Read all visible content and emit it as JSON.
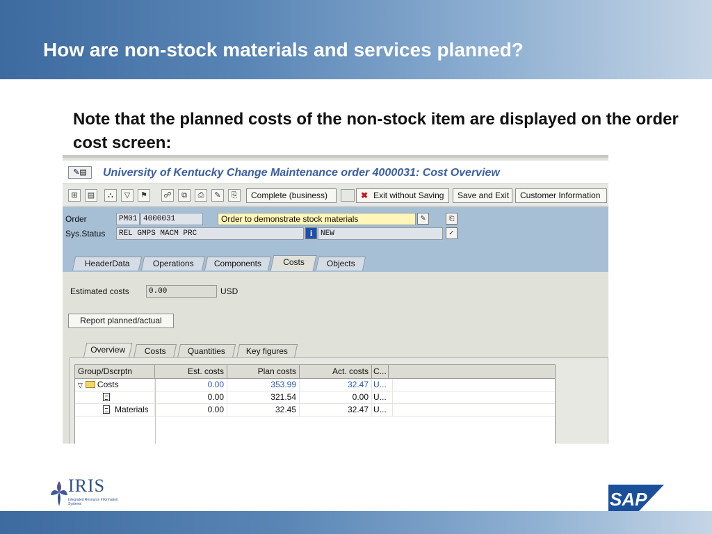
{
  "slide": {
    "title": "How are non-stock materials and services planned?",
    "note": "Note that the planned costs of the non-stock item are displayed on the order cost screen:"
  },
  "sap_window": {
    "title": "University of Kentucky Change Maintenance order 4000031: Cost Overview",
    "toolbar": {
      "complete_label": "Complete (business)",
      "exit_label": "Exit without Saving",
      "save_exit_label": "Save and Exit",
      "customer_info_label": "Customer Information"
    },
    "header": {
      "order_label": "Order",
      "order_type": "PM01",
      "order_number": "4000031",
      "order_description": "Order to demonstrate stock materials",
      "sys_status_label": "Sys.Status",
      "sys_status_value": "REL  GMPS MACM PRC",
      "user_status_value": "NEW"
    },
    "tabs": [
      "HeaderData",
      "Operations",
      "Components",
      "Costs",
      "Objects"
    ],
    "active_tab": "Costs",
    "costs": {
      "estimated_label": "Estimated costs",
      "estimated_value": "0.00",
      "currency": "USD",
      "report_button": "Report planned/actual",
      "sub_tabs": [
        "Overview",
        "Costs",
        "Quantities",
        "Key figures"
      ],
      "active_sub_tab": "Overview",
      "table": {
        "columns": [
          "Group/Dscrptn",
          "Est. costs",
          "Plan costs",
          "Act. costs",
          "C..."
        ],
        "rows": [
          {
            "desc": "Costs",
            "est": "0.00",
            "plan": "353.99",
            "act": "32.47",
            "cur": "U..."
          },
          {
            "desc": "",
            "est": "0.00",
            "plan": "321.54",
            "act": "0.00",
            "cur": "U..."
          },
          {
            "desc": "Materials",
            "est": "0.00",
            "plan": "32.45",
            "act": "32.47",
            "cur": "U..."
          }
        ]
      }
    }
  },
  "logos": {
    "iris_word": "IRIS",
    "iris_sub": "Integrated Resource Information Systems",
    "sap_word": "SAP"
  },
  "colors": {
    "title_band": "#3d6a9f",
    "sap_title_text": "#3b5ea3",
    "status_area": "#a6bfd5",
    "description_field": "#fff6b8",
    "root_row_values": "#2459b3",
    "sap_logo_blue": "#1a4f9c"
  }
}
